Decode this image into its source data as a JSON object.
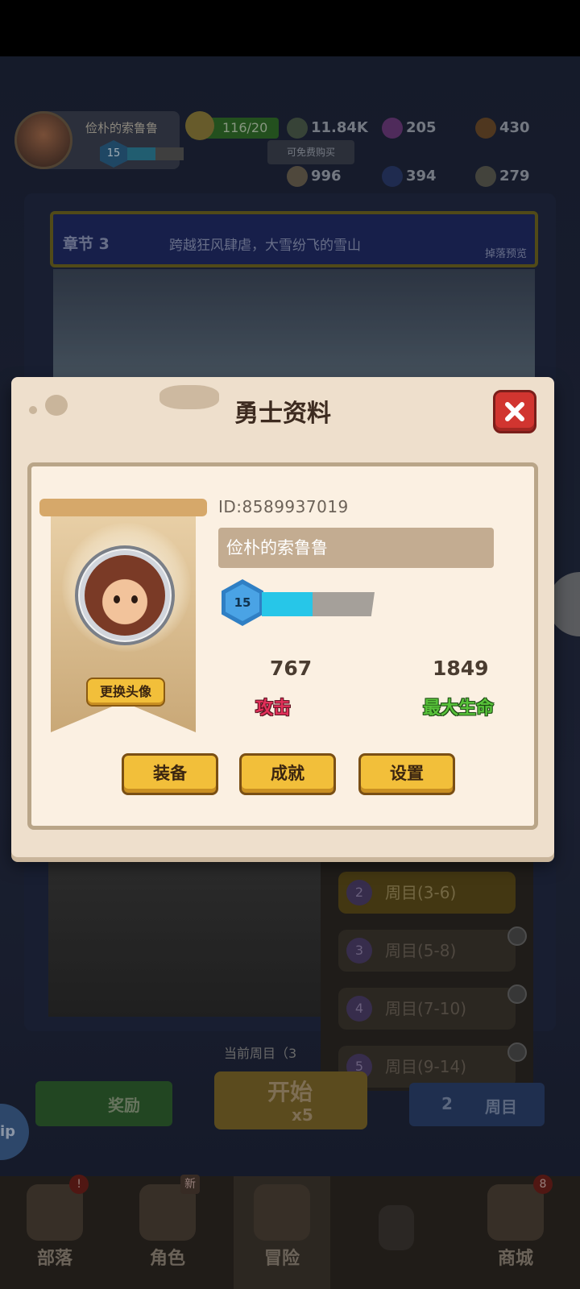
{
  "background": {
    "player_name": "俭朴的索鲁鲁",
    "player_level": "15",
    "stamina": "116/20",
    "gold": "11.84K",
    "free_buy": "可免费购买",
    "purple_gem": "205",
    "wood": "430",
    "food": "996",
    "crystal": "394",
    "stone": "279",
    "chapter_title": "章节 3",
    "chapter_desc": "跨越狂风肆虐，大雪纷飞的雪山",
    "drop_preview": "掉落预览",
    "current_round": "当前周目（3",
    "rounds": [
      {
        "badge": "2",
        "label": "周目(3-6)"
      },
      {
        "badge": "3",
        "label": "周目(5-8)"
      },
      {
        "badge": "4",
        "label": "周目(7-10)"
      },
      {
        "badge": "5",
        "label": "周目(9-14)"
      }
    ],
    "reward_label": "奖励",
    "start_label": "开始",
    "start_cost": "x5",
    "round_btn_badge": "2",
    "round_btn_label": "周目",
    "side_label": "ip"
  },
  "navbar": {
    "items": [
      {
        "label": "部落",
        "badge": "!"
      },
      {
        "label": "角色",
        "badge": "新"
      },
      {
        "label": "冒险",
        "badge": ""
      },
      {
        "label": "",
        "badge": ""
      },
      {
        "label": "商城",
        "badge": "8"
      }
    ]
  },
  "dialog": {
    "title": "勇士资料",
    "player_id": "ID:8589937019",
    "player_name": "俭朴的索鲁鲁",
    "level": "15",
    "level_progress": 0.45,
    "attack_value": "767",
    "attack_label": "攻击",
    "hp_value": "1849",
    "hp_label": "最大生命",
    "change_avatar": "更换头像",
    "buttons": {
      "equip": "装备",
      "achievements": "成就",
      "settings": "设置"
    }
  },
  "colors": {
    "dialog_bg": "#eedfcc",
    "yellow_button": "#f2bf3a",
    "close_red": "#d13530",
    "attack_pink": "#e2305a",
    "hp_green": "#58c23a"
  }
}
